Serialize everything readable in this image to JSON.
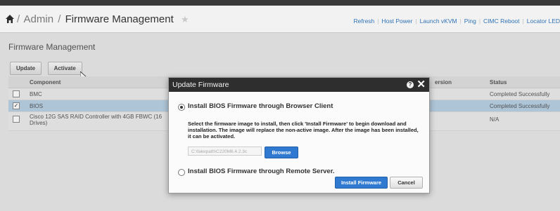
{
  "breadcrumb": {
    "root": "Admin",
    "separator": "/",
    "current": "Firmware Management"
  },
  "top_links": [
    "Refresh",
    "Host Power",
    "Launch vKVM",
    "Ping",
    "CIMC Reboot",
    "Locator LED"
  ],
  "section_title": "Firmware Management",
  "toolbar": {
    "update_label": "Update",
    "activate_label": "Activate"
  },
  "table": {
    "headers": {
      "component": "Component",
      "version": "ersion",
      "status": "Status"
    },
    "rows": [
      {
        "component": "BMC",
        "status": "Completed Successfully",
        "checked": false,
        "selected": false
      },
      {
        "component": "BIOS",
        "status": "Completed Successfully",
        "checked": true,
        "selected": true
      },
      {
        "component": "Cisco 12G SAS RAID Controller with 4GB FBWC (16 Drives)",
        "status": "N/A",
        "checked": false,
        "selected": false
      }
    ]
  },
  "modal": {
    "title": "Update Firmware",
    "option_browser": "Install BIOS Firmware through Browser Client",
    "instructions": "Select the firmware image to install, then click 'Install Firmware' to begin download and installation. The image will replace the non-active image. After the image has been installed, it can be activated.",
    "file_path_value": "C:\\fakepath\\C220M6.4.2.3c",
    "browse_label": "Browse",
    "option_remote": "Install BIOS Firmware through Remote Server.",
    "install_label": "Install Firmware",
    "cancel_label": "Cancel",
    "selected_option": "browser"
  },
  "colors": {
    "accent": "#2f7ad0",
    "link": "#2f72b5",
    "modal_header": "#2e2e2e",
    "selected_row": "#b8d1e6"
  },
  "icons": {
    "home": "home-icon",
    "favorite": "star-icon",
    "help": "help-icon",
    "close": "close-icon",
    "cursor": "cursor-icon"
  }
}
